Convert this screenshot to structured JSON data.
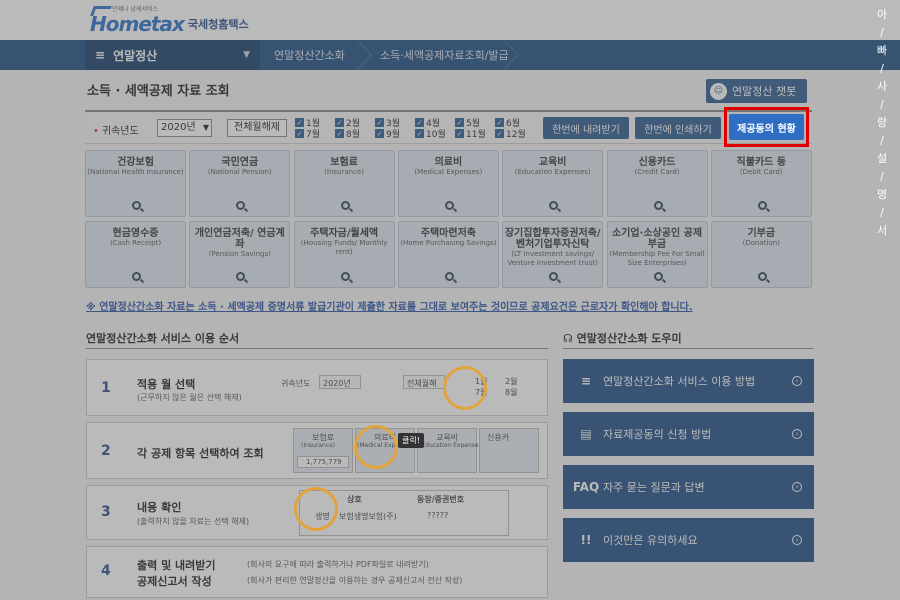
{
  "header": {
    "logo_small": "언제나 납세서비스",
    "logo_brand": "Hometax",
    "logo_kor": "국세청홈택스"
  },
  "nav": {
    "menu_label": "연말정산",
    "crumbs": [
      "연말정산간소화",
      "소득·세액공제자료조회/발급"
    ]
  },
  "page": {
    "title": "소득 · 세액공제 자료 조회",
    "chatbot_label": "연말정산 챗봇"
  },
  "filter": {
    "year_label": "귀속년도",
    "year_value": "2020년",
    "select_all_label": "전체월해제",
    "months": [
      "1월",
      "2월",
      "3월",
      "4월",
      "5월",
      "6월",
      "7월",
      "8월",
      "9월",
      "10월",
      "11월",
      "12월"
    ],
    "download_label": "한번에 내려받기",
    "print_label": "한번에 인쇄하기",
    "provider_label": "제공동의 현황"
  },
  "tiles": [
    {
      "k": "건강보험",
      "e": "(National Health Insurance)"
    },
    {
      "k": "국민연금",
      "e": "(National Pension)"
    },
    {
      "k": "보험료",
      "e": "(Insurance)"
    },
    {
      "k": "의료비",
      "e": "(Medical Expenses)"
    },
    {
      "k": "교육비",
      "e": "(Education Expenses)"
    },
    {
      "k": "신용카드",
      "e": "(Credit Card)"
    },
    {
      "k": "직불카드 등",
      "e": "(Debit Card)"
    },
    {
      "k": "현금영수증",
      "e": "(Cash Receipt)"
    },
    {
      "k": "개인연금저축/ 연금계좌",
      "e": "(Pension Savings)"
    },
    {
      "k": "주택자금/월세액",
      "e": "(Housing Funds/ Monthly rent)"
    },
    {
      "k": "주택마련저축",
      "e": "(Home Purchasing Savings)"
    },
    {
      "k": "장기집합투자증권저축/ 벤처기업투자신탁",
      "e": "(LT investment savings/ Venture investment trust)"
    },
    {
      "k": "소기업·소상공인 공제부금",
      "e": "(Membership Fee For Small Size Enterprises)"
    },
    {
      "k": "기부금",
      "e": "(Donation)"
    }
  ],
  "notice": "※ 연말정산간소화 자료는 소득 · 세액공제 증명서류 발급기관이 제출한 자료를 그대로 보여주는 것이므로 공제요건은 근로자가 확인해야 합니다.",
  "steps_section": {
    "title": "연말정산간소화 서비스 이용 순서",
    "steps": [
      {
        "num": "1",
        "t1": "적용 월 선택",
        "t2": "(근무하지 않은 월은 선택 해제)"
      },
      {
        "num": "2",
        "t1": "각 공제 항목 선택하여 조회",
        "t2": ""
      },
      {
        "num": "3",
        "t1": "내용 확인",
        "t2": "(출력하지 않을 자료는 선택 해제)"
      },
      {
        "num": "4",
        "t1": "출력 및 내려받기",
        "t1b": "공제신고서 작성",
        "t2": "(회사의 요구에 따라 출력하거나 PDF파일로 내려받기)",
        "t2b": "(회사가 편리한 연말정산을 이용하는 경우 공제신고서 전산 작성)"
      }
    ],
    "mini": {
      "s1_year_label": "귀속년도",
      "s1_year": "2020년",
      "s1_btn": "전체월해",
      "s1_m1": "1월",
      "s1_m7": "7월",
      "s1_m2": "2월",
      "s1_m8": "8월",
      "s2_t1": "보험료",
      "s2_e1": "(Insurance)",
      "s2_amount": "1,775,779",
      "s2_t2": "의료비",
      "s2_e2": "(Medical Expenses)",
      "s2_t3": "교육비",
      "s2_e3": "(Education Expenses)",
      "s2_t4": "신용카",
      "s2_click": "클릭!",
      "s3_h1": "상호",
      "s3_h2": "등장/증권번호",
      "s3_r1": "생명",
      "s3_r1b": "보험생명보험(주)",
      "s3_r1c": "?????"
    }
  },
  "help_section": {
    "title": "연말정산간소화 도우미",
    "items": [
      {
        "icon": "≡",
        "label": "연말정산간소화 서비스 이용 방법"
      },
      {
        "icon": "▤",
        "label": "자료제공동의 신청 방법"
      },
      {
        "icon": "FAQ",
        "label": "자주 묻는 질문과 답변"
      },
      {
        "icon": "!!",
        "label": "이것만은 유의하세요"
      }
    ]
  },
  "side_text": [
    "아",
    "빠",
    "사",
    "랑",
    "설",
    "명",
    "서"
  ]
}
